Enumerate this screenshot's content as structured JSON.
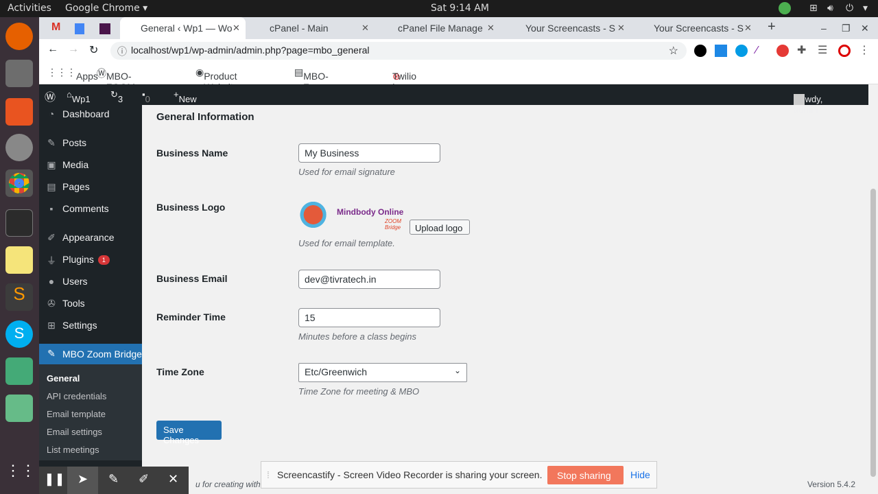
{
  "os": {
    "activities": "Activities",
    "app": "Google Chrome",
    "clock": "Sat  9:14 AM"
  },
  "tabs": [
    "",
    "",
    "",
    "General ‹ Wp1 — Wo",
    "cPanel - Main",
    "cPanel File Manage",
    "Your Screencasts - S",
    "Your Screencasts - S"
  ],
  "url": "localhost/wp1/wp-admin/admin.php?page=mbo_general",
  "bookmarks": [
    "Apps",
    "MBO-ZOOM-P...",
    "Product Website",
    "MBO-Zoom-Pl...",
    "Twilio | Login"
  ],
  "wpbar": {
    "site": "Wp1",
    "updates": "3",
    "comments": "0",
    "new": "New",
    "howdy": "Howdy, admin"
  },
  "menu": {
    "dashboard": "Dashboard",
    "posts": "Posts",
    "media": "Media",
    "pages": "Pages",
    "comments": "Comments",
    "appearance": "Appearance",
    "plugins": "Plugins",
    "plugins_badge": "1",
    "users": "Users",
    "tools": "Tools",
    "settings": "Settings",
    "mbo": "MBO Zoom Bridge"
  },
  "submenu": {
    "general": "General",
    "api": "API credentials",
    "email_template": "Email template",
    "email_settings": "Email settings",
    "list": "List meetings"
  },
  "form": {
    "title": "General Information",
    "business_name_label": "Business Name",
    "business_name": "My Business",
    "business_name_desc": "Used for email signature",
    "logo_label": "Business Logo",
    "logo_text": "Mindbody Online",
    "logo_sub": "ZOOM Bridge",
    "upload": "Upload logo",
    "logo_desc": "Used for email template.",
    "email_label": "Business Email",
    "email": "dev@tivratech.in",
    "reminder_label": "Reminder Time",
    "reminder": "15",
    "reminder_desc": "Minutes before a class begins",
    "tz_label": "Time Zone",
    "tz": "Etc/Greenwich",
    "tz_desc": "Time Zone for meeting & MBO",
    "save": "Save Changes"
  },
  "footer": {
    "thanks": "u for creating with",
    "version": "Version 5.4.2"
  },
  "share": {
    "msg": "Screencastify - Screen Video Recorder is sharing your screen.",
    "stop": "Stop sharing",
    "hide": "Hide"
  }
}
